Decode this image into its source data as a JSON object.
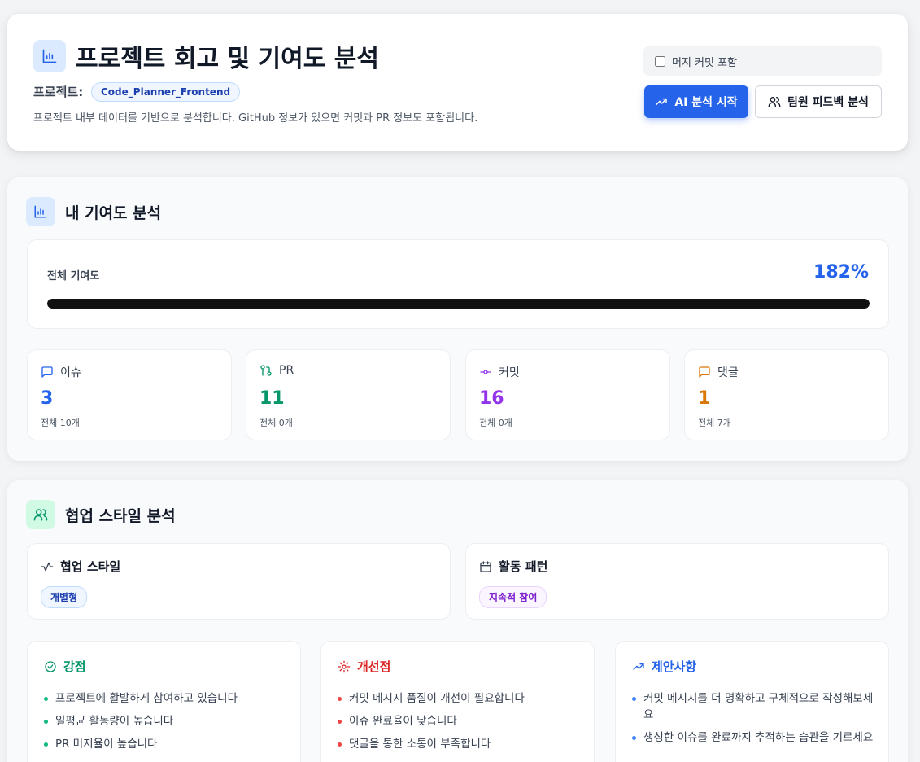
{
  "header": {
    "title": "프로젝트 회고 및 기여도 분석",
    "project_label": "프로젝트:",
    "project_name": "Code_Planner_Frontend",
    "description": "프로젝트 내부 데이터를 기반으로 분석합니다. GitHub 정보가 있으면 커밋과 PR 정보도 포함됩니다.",
    "merge_checkbox_label": "머지 커밋 포함",
    "merge_checkbox_checked": false,
    "ai_button_label": "AI 분석 시작",
    "feedback_button_label": "팀원 피드백 분석"
  },
  "contribution": {
    "section_title": "내 기여도 분석",
    "total_label": "전체 기여도",
    "total_value": "182%",
    "progress_fraction": 1.0,
    "stats": [
      {
        "title": "이슈",
        "value": "3",
        "sub": "전체 10개",
        "color": "#2563eb",
        "icon": "message-square-icon"
      },
      {
        "title": "PR",
        "value": "11",
        "sub": "전체 0개",
        "color": "#059669",
        "icon": "git-pull-request-icon"
      },
      {
        "title": "커밋",
        "value": "16",
        "sub": "전체 0개",
        "color": "#9333ea",
        "icon": "git-commit-icon"
      },
      {
        "title": "댓글",
        "value": "1",
        "sub": "전체 7개",
        "color": "#d97706",
        "icon": "comment-icon"
      }
    ]
  },
  "collaboration": {
    "section_title": "협업 스타일 분석",
    "style_title": "협업 스타일",
    "style_value": "개별형",
    "pattern_title": "활동 패턴",
    "pattern_value": "지속적 참여",
    "strengths": {
      "title": "강점",
      "color": "#059669",
      "items": [
        "프로젝트에 활발하게 참여하고 있습니다",
        "일평균 활동량이 높습니다",
        "PR 머지율이 높습니다"
      ]
    },
    "improvements": {
      "title": "개선점",
      "color": "#dc2626",
      "items": [
        "커밋 메시지 품질이 개선이 필요합니다",
        "이슈 완료율이 낮습니다",
        "댓글을 통한 소통이 부족합니다"
      ]
    },
    "suggestions": {
      "title": "제안사항",
      "color": "#2563eb",
      "items": [
        "커밋 메시지를 더 명확하고 구체적으로 작성해보세요",
        "생성한 이슈를 완료까지 추적하는 습관을 기르세요"
      ]
    }
  }
}
